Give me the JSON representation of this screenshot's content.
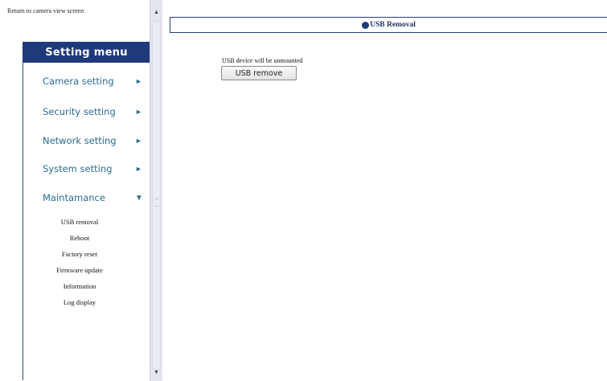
{
  "left": {
    "return_link": "Return to camera view screen",
    "menu_title": "Setting menu",
    "items": [
      {
        "label": "Camera setting",
        "arrow": "►"
      },
      {
        "label": "Security setting",
        "arrow": "►"
      },
      {
        "label": "Network setting",
        "arrow": "►"
      },
      {
        "label": "System setting",
        "arrow": "►"
      },
      {
        "label": "Maintamance",
        "arrow": "▼"
      }
    ],
    "subitems": [
      "USB removal",
      "Reboot",
      "Factory reset",
      "Firmware update",
      "Information",
      "Log display"
    ]
  },
  "scrollbar": {
    "up_arrow": "▲",
    "down_arrow": "▼"
  },
  "main": {
    "title": "USB Removal",
    "message": "USB device will be unmounted",
    "button_label": "USB remove"
  }
}
